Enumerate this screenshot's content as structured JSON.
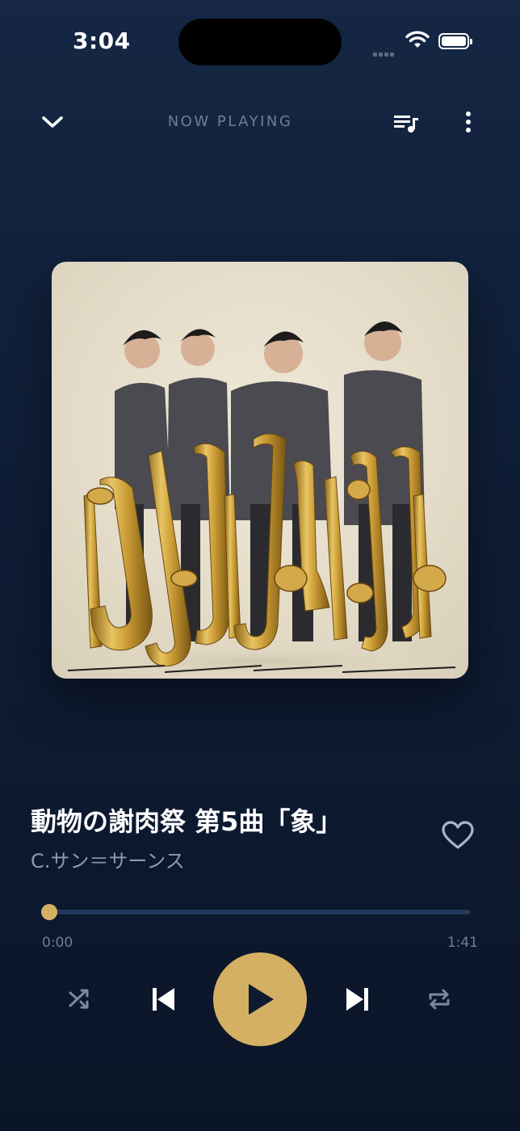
{
  "status_bar": {
    "time": "3:04"
  },
  "header": {
    "label": "NOW PLAYING"
  },
  "track": {
    "title": "動物の謝肉祭 第5曲「象」",
    "artist": "C.サン＝サーンス",
    "favorited": false
  },
  "progress": {
    "current": "0:00",
    "duration": "1:41",
    "fraction": 0
  },
  "colors": {
    "accent": "#d4b064",
    "background_top": "#152744",
    "background_bottom": "#0b1528",
    "muted_text": "#6f7e96"
  },
  "icons": {
    "collapse": "chevron-down-icon",
    "queue": "queue-music-icon",
    "more": "more-vertical-icon",
    "favorite": "heart-icon",
    "shuffle": "shuffle-icon",
    "previous": "skip-previous-icon",
    "play": "play-icon",
    "next": "skip-next-icon",
    "repeat": "repeat-icon"
  }
}
